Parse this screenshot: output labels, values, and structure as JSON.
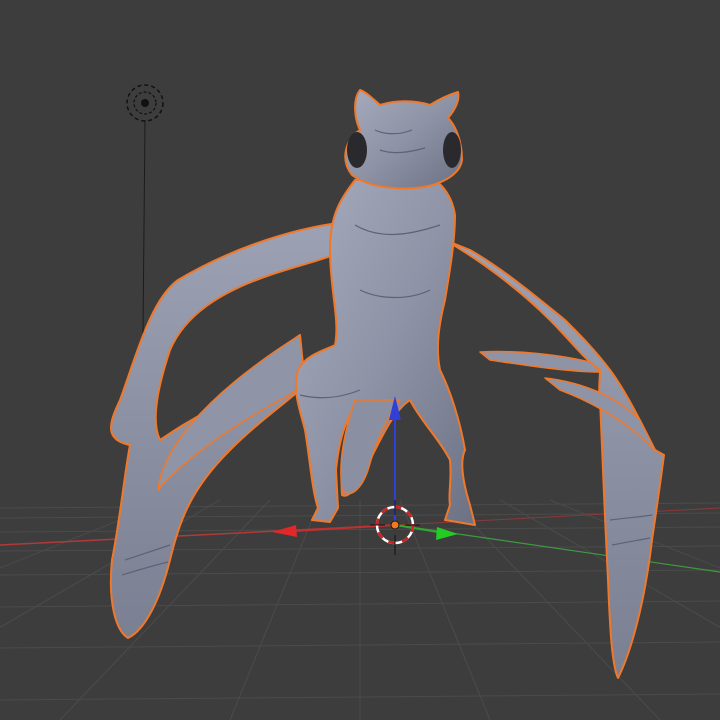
{
  "viewport": {
    "background": "#3d3d3d",
    "grid_color": "#4a4a4a",
    "grid_show": true
  },
  "axes": {
    "x_color": "#b03a3a",
    "y_color": "#3f9a3f",
    "z_color": "#2f3fd8",
    "show": true
  },
  "object": {
    "type": "character-mesh",
    "selected": true,
    "mesh_color": "#8e93a6",
    "outline_color": "#f0782a"
  },
  "gizmo": {
    "type": "translate",
    "arrows": [
      "x-arrow",
      "y-arrow",
      "z-arrow"
    ]
  },
  "lamp": {
    "icon": "lamp-icon"
  },
  "cursor": {
    "icon": "3d-cursor-icon"
  }
}
